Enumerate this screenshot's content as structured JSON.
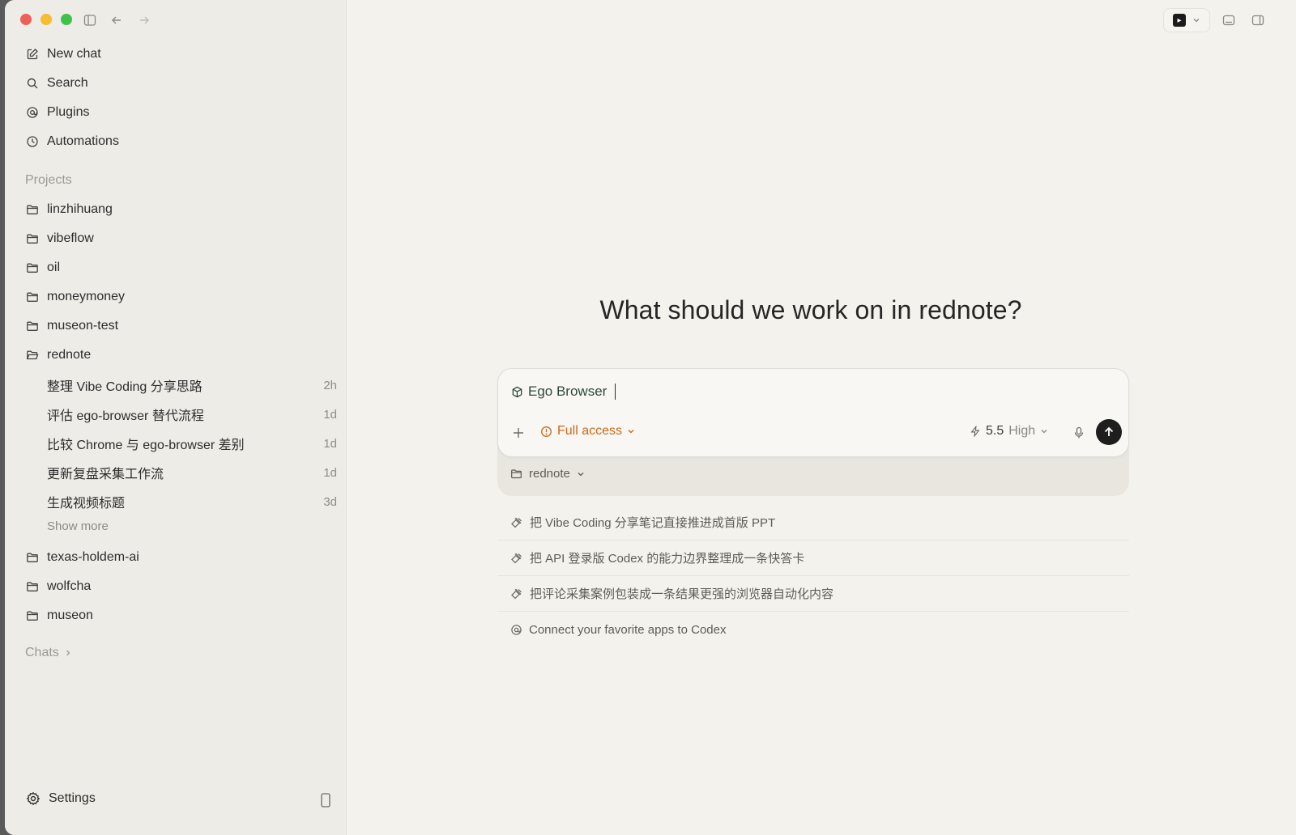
{
  "sidebar": {
    "nav": [
      {
        "label": "New chat",
        "icon": "edit-icon"
      },
      {
        "label": "Search",
        "icon": "search-icon"
      },
      {
        "label": "Plugins",
        "icon": "plugins-icon"
      },
      {
        "label": "Automations",
        "icon": "clock-icon"
      }
    ],
    "projects_label": "Projects",
    "projects": [
      {
        "label": "linzhihuang"
      },
      {
        "label": "vibeflow"
      },
      {
        "label": "oil"
      },
      {
        "label": "moneymoney"
      },
      {
        "label": "museon-test"
      },
      {
        "label": "rednote"
      }
    ],
    "rednote_chats": [
      {
        "title": "整理 Vibe Coding 分享思路",
        "time": "2h"
      },
      {
        "title": "评估 ego-browser 替代流程",
        "time": "1d"
      },
      {
        "title": "比较 Chrome 与 ego-browser 差别",
        "time": "1d"
      },
      {
        "title": "更新复盘采集工作流",
        "time": "1d"
      },
      {
        "title": "生成视频标题",
        "time": "3d"
      }
    ],
    "show_more": "Show more",
    "projects_after": [
      {
        "label": "texas-holdem-ai"
      },
      {
        "label": "wolfcha"
      },
      {
        "label": "museon"
      }
    ],
    "chats_label": "Chats",
    "settings_label": "Settings"
  },
  "main": {
    "headline": "What should we work on in rednote?",
    "composer": {
      "input_value": "Ego Browser",
      "access_label": "Full access",
      "model_version": "5.5",
      "model_level": "High",
      "folder": "rednote"
    },
    "suggestions": [
      {
        "text": "把 Vibe Coding 分享笔记直接推进成首版 PPT"
      },
      {
        "text": "把 API 登录版 Codex 的能力边界整理成一条快答卡"
      },
      {
        "text": "把评论采集案例包装成一条结果更强的浏览器自动化内容"
      }
    ],
    "connect_text": "Connect your favorite apps to Codex"
  },
  "colors": {
    "accent_access": "#c96a1b",
    "background": "#f4f2ec",
    "sidebar": "#eeece6"
  }
}
